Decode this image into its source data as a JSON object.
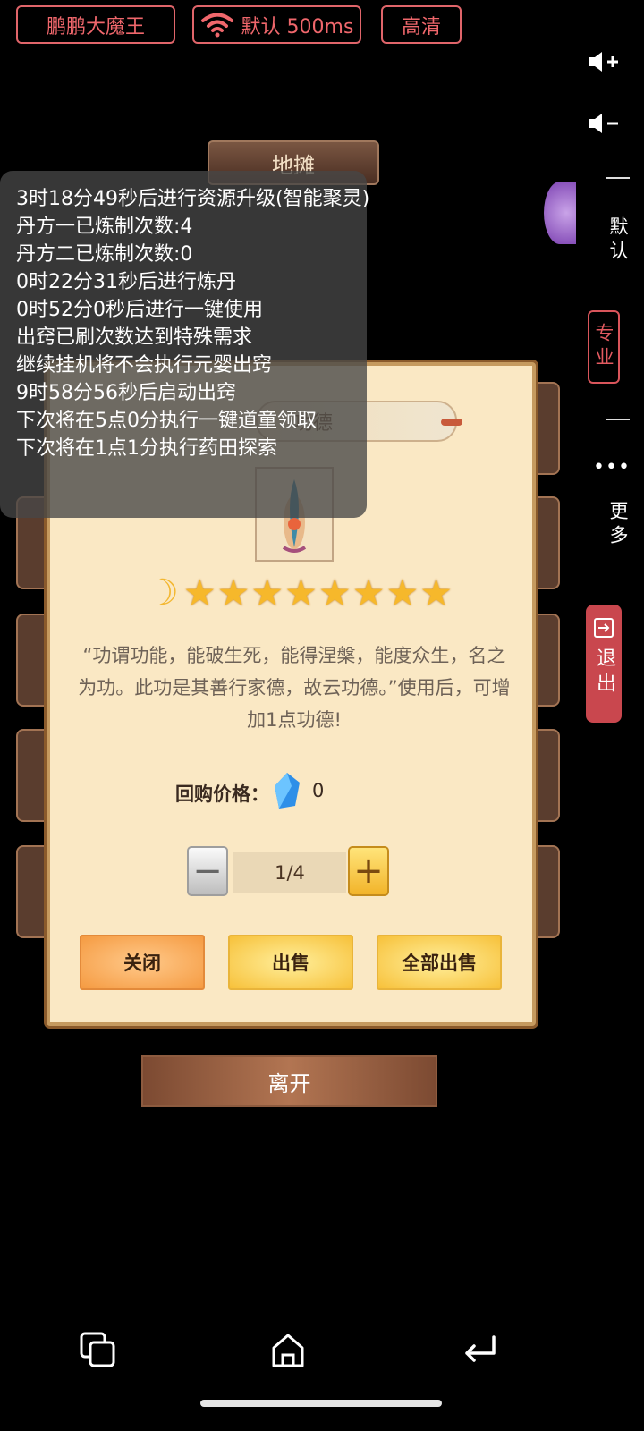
{
  "top_bar": {
    "account_name": "鹏鹏大魔王",
    "network_label": "默认 500ms",
    "quality_label": "高清"
  },
  "side_panel": {
    "default_label": "默认",
    "pro_label": "专业",
    "more_label": "更多",
    "exit_label": "退出"
  },
  "scene": {
    "banner_title": "地摊"
  },
  "log": {
    "lines": [
      "3时18分49秒后进行资源升级(智能聚灵)",
      "丹方一已炼制次数:4",
      "丹方二已炼制次数:0",
      "0时22分31秒后进行炼丹",
      "0时52分0秒后进行一键使用",
      "出窍已刷次数达到特殊需求",
      "继续挂机将不会执行元婴出窍",
      "9时58分56秒后启动出窍",
      "下次将在5点0分执行一键道童领取",
      "下次将在1点1分执行药田探索"
    ]
  },
  "dialog": {
    "item_name": "功德",
    "star_count": 8,
    "description": "“功谓功能，能破生死，能得涅槃，能度众生，名之为功。此功是其善行家德，故云功德。”使用后，可增加1点功德!",
    "price_label": "回购价格：",
    "price_value": "0",
    "quantity": "1/4",
    "buttons": {
      "close": "关闭",
      "sell": "出售",
      "sell_all": "全部出售"
    }
  },
  "leave_button": "离开",
  "colors": {
    "accent_red": "#e0656a",
    "dialog_bg": "#fae8c4",
    "star_gold": "#f6b82b",
    "exit_bg": "#c9474e"
  }
}
